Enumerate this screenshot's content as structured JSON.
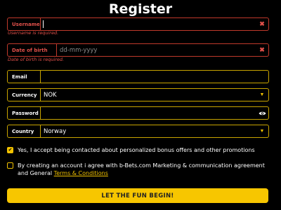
{
  "title": "Register",
  "fields": {
    "username": {
      "label": "Username",
      "value": "",
      "error": "Username is required."
    },
    "dob": {
      "label": "Date of birth",
      "placeholder": "dd-mm-yyyy",
      "error": "Date of birth is required."
    },
    "email": {
      "label": "Email",
      "value": ""
    },
    "currency": {
      "label": "Currency",
      "value": "NOK"
    },
    "password": {
      "label": "Password",
      "value": ""
    },
    "country": {
      "label": "Country",
      "value": "Norway"
    }
  },
  "consents": {
    "promotions": {
      "text": "Yes, I accept being contacted about personalized bonus offers and other promotions",
      "checked": true
    },
    "terms": {
      "text": "By creating an account i agree with b-Bets.com Marketing & communication agreement and General ",
      "link": "Terms & Conditions",
      "checked": false
    }
  },
  "cta_label": "LET THE FUN BEGIN!",
  "colors": {
    "accent": "#f7c600",
    "error": "#e0504a",
    "background": "#000000"
  }
}
